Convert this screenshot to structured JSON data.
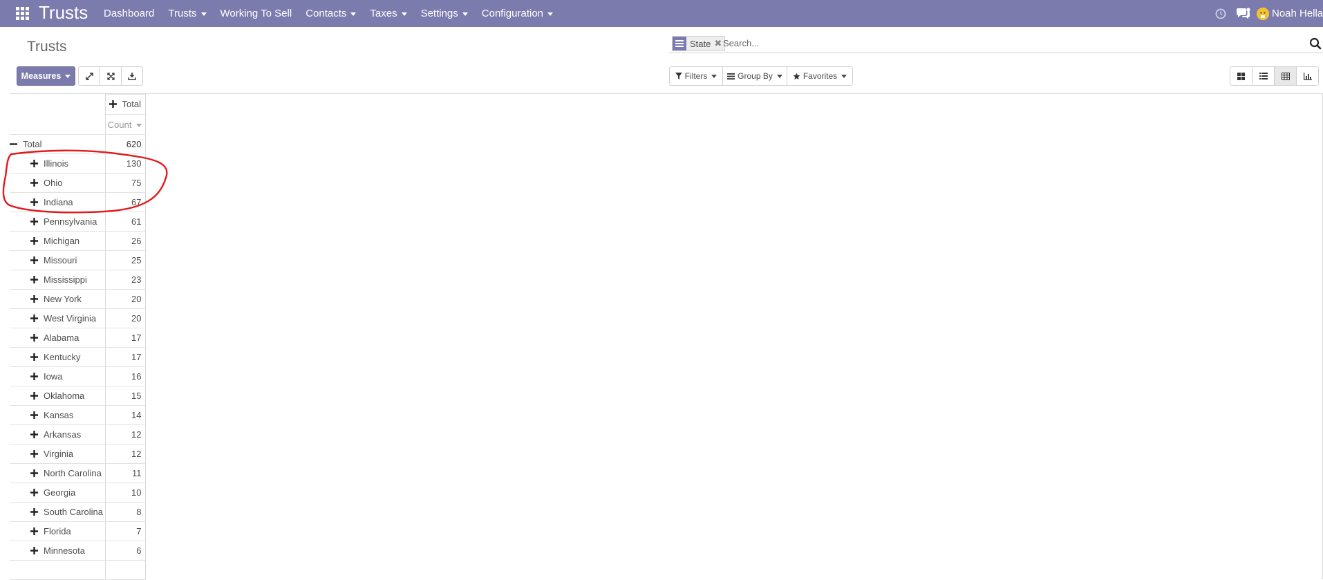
{
  "navbar": {
    "brand": "Trusts",
    "menu": [
      {
        "label": "Dashboard",
        "dropdown": false
      },
      {
        "label": "Trusts",
        "dropdown": true
      },
      {
        "label": "Working To Sell",
        "dropdown": false
      },
      {
        "label": "Contacts",
        "dropdown": true
      },
      {
        "label": "Taxes",
        "dropdown": true
      },
      {
        "label": "Settings",
        "dropdown": true
      },
      {
        "label": "Configuration",
        "dropdown": true
      }
    ],
    "user_name": "Noah Hellan",
    "accent": "#7c7bad"
  },
  "page": {
    "title": "Trusts"
  },
  "search": {
    "facet_label": "State",
    "facet_icon": "group-by-icon",
    "placeholder": "Search..."
  },
  "toolbar": {
    "measures_label": "Measures",
    "filters_label": "Filters",
    "groupby_label": "Group By",
    "favorites_label": "Favorites"
  },
  "pivot": {
    "col_header": "Total",
    "measure": "Count",
    "total_label": "Total",
    "total_value": "620",
    "rows": [
      {
        "label": "Illinois",
        "value": "130"
      },
      {
        "label": "Ohio",
        "value": "75"
      },
      {
        "label": "Indiana",
        "value": "67"
      },
      {
        "label": "Pennsylvania",
        "value": "61"
      },
      {
        "label": "Michigan",
        "value": "26"
      },
      {
        "label": "Missouri",
        "value": "25"
      },
      {
        "label": "Mississippi",
        "value": "23"
      },
      {
        "label": "New York",
        "value": "20"
      },
      {
        "label": "West Virginia",
        "value": "20"
      },
      {
        "label": "Alabama",
        "value": "17"
      },
      {
        "label": "Kentucky",
        "value": "17"
      },
      {
        "label": "Iowa",
        "value": "16"
      },
      {
        "label": "Oklahoma",
        "value": "15"
      },
      {
        "label": "Kansas",
        "value": "14"
      },
      {
        "label": "Arkansas",
        "value": "12"
      },
      {
        "label": "Virginia",
        "value": "12"
      },
      {
        "label": "North Carolina",
        "value": "11"
      },
      {
        "label": "Georgia",
        "value": "10"
      },
      {
        "label": "South Carolina",
        "value": "8"
      },
      {
        "label": "Florida",
        "value": "7"
      },
      {
        "label": "Minnesota",
        "value": "6"
      },
      {
        "label": "",
        "value": ""
      }
    ]
  },
  "annotation": {
    "color": "#e3191c",
    "shape": "hand-drawn-circle"
  }
}
